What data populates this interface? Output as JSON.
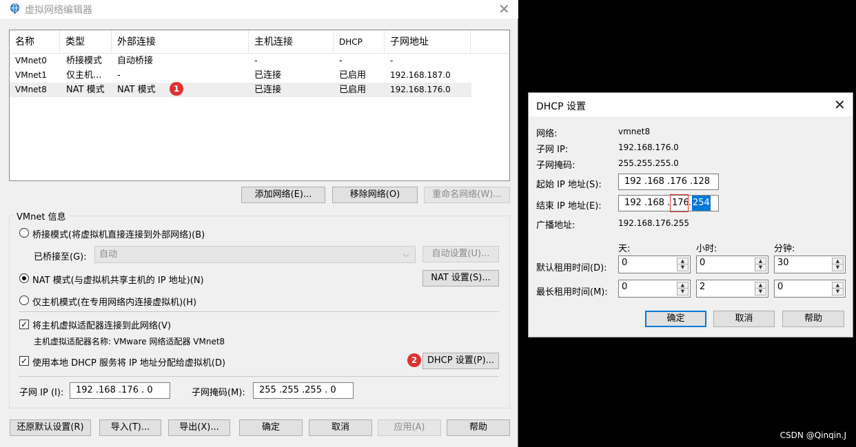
{
  "main_window": {
    "title": "虚拟网络编辑器",
    "columns": [
      "名称",
      "类型",
      "外部连接",
      "主机连接",
      "DHCP",
      "子网地址"
    ],
    "rows": [
      {
        "name": "VMnet0",
        "type": "桥接模式",
        "external": "自动桥接",
        "host": "-",
        "dhcp": "-",
        "subnet": "-"
      },
      {
        "name": "VMnet1",
        "type": "仅主机...",
        "external": "-",
        "host": "已连接",
        "dhcp": "已启用",
        "subnet": "192.168.187.0"
      },
      {
        "name": "VMnet8",
        "type": "NAT 模式",
        "external": "NAT 模式",
        "host": "已连接",
        "dhcp": "已启用",
        "subnet": "192.168.176.0",
        "selected": true
      }
    ],
    "list_buttons": {
      "add": "添加网络(E)...",
      "remove": "移除网络(O)",
      "rename": "重命名网络(W)..."
    },
    "vmnet_info": {
      "title": "VMnet 信息",
      "bridge_radio": "桥接模式(将虚拟机直接连接到外部网络)(B)",
      "bridged_to_label": "已桥接至(G):",
      "bridged_to_value": "自动",
      "auto_settings": "自动设置(U)...",
      "nat_radio": "NAT 模式(与虚拟机共享主机的 IP 地址)(N)",
      "nat_settings": "NAT 设置(S)...",
      "hostonly_radio": "仅主机模式(在专用网络内连接虚拟机)(H)",
      "selected_mode": "nat",
      "connect_adapter": "将主机虚拟适配器连接到此网络(V)",
      "connect_adapter_checked": true,
      "adapter_name": "主机虚拟适配器名称: VMware 网络适配器 VMnet8",
      "use_dhcp": "使用本地 DHCP 服务将 IP 地址分配给虚拟机(D)",
      "use_dhcp_checked": true,
      "dhcp_settings": "DHCP 设置(P)...",
      "subnet_ip_label": "子网 IP (I):",
      "subnet_ip": "192 .168 .176 . 0",
      "subnet_mask_label": "子网掩码(M):",
      "subnet_mask": "255 .255 .255 . 0"
    },
    "bottom_buttons": {
      "restore": "还原默认设置(R)",
      "import": "导入(T)...",
      "export": "导出(X)...",
      "ok": "确定",
      "cancel": "取消",
      "apply": "应用(A)",
      "help": "帮助"
    },
    "badges": [
      "1",
      "2"
    ]
  },
  "dhcp_dialog": {
    "title": "DHCP 设置",
    "network_label": "网络:",
    "network_value": "vmnet8",
    "subnet_ip_label": "子网 IP:",
    "subnet_ip_value": "192.168.176.0",
    "subnet_mask_label": "子网掩码:",
    "subnet_mask_value": "255.255.255.0",
    "start_ip_label": "起始 IP 地址(S):",
    "start_ip": "192 .168 .176 .128",
    "end_ip_label": "结束 IP 地址(E):",
    "end_ip_prefix": "192 .168 .",
    "end_ip_third": "176",
    "end_ip_dot": ".",
    "end_ip_last": "254",
    "broadcast_label": "广播地址:",
    "broadcast_value": "192.168.176.255",
    "col_days": "天:",
    "col_hours": "小时:",
    "col_minutes": "分钟:",
    "default_lease_label": "默认租用时间(D):",
    "default_lease": {
      "days": "0",
      "hours": "0",
      "minutes": "30"
    },
    "max_lease_label": "最长租用时间(M):",
    "max_lease": {
      "days": "0",
      "hours": "2",
      "minutes": "0"
    },
    "ok": "确定",
    "cancel": "取消",
    "help": "帮助"
  },
  "watermark": "CSDN @Qinqin.J",
  "colors": {
    "badge": "#e03030",
    "selection": "#0078d7",
    "highlight_box": "#e03030"
  }
}
